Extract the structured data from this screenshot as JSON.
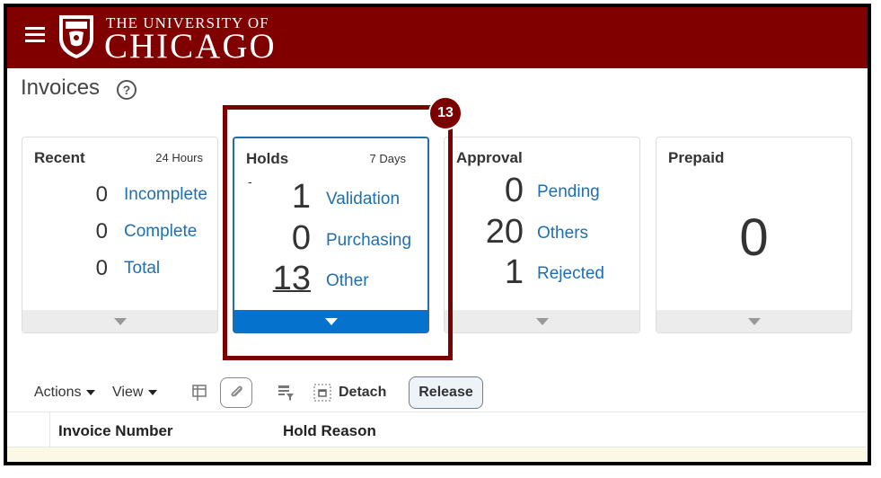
{
  "header": {
    "brand_top": "THE UNIVERSITY OF",
    "brand_main": "CHICAGO",
    "bg_color": "#800000"
  },
  "page": {
    "title": "Invoices",
    "help_icon": "question-circle-icon"
  },
  "cards": {
    "recent": {
      "title": "Recent",
      "period": "24 Hours",
      "rows": [
        {
          "count": "0",
          "label": "Incomplete"
        },
        {
          "count": "0",
          "label": "Complete"
        },
        {
          "count": "0",
          "label": "Total"
        }
      ]
    },
    "holds": {
      "title": "Holds",
      "period": "7 Days",
      "dash": "-",
      "rows": [
        {
          "count": "1",
          "label": "Validation"
        },
        {
          "count": "0",
          "label": "Purchasing"
        },
        {
          "count": "13",
          "label": "Other"
        }
      ]
    },
    "approval": {
      "title": "Approval",
      "rows": [
        {
          "count": "0",
          "label": "Pending"
        },
        {
          "count": "20",
          "label": "Others"
        },
        {
          "count": "1",
          "label": "Rejected"
        }
      ]
    },
    "prepaid": {
      "title": "Prepaid",
      "count": "0"
    }
  },
  "callout": {
    "badge": "13",
    "color": "#7b0000"
  },
  "toolbar": {
    "actions_label": "Actions",
    "view_label": "View",
    "detach_label": "Detach",
    "release_label": "Release"
  },
  "table": {
    "columns": [
      "Invoice Number",
      "Hold Reason"
    ]
  },
  "colors": {
    "link": "#1f6fb0",
    "accent": "#0572ce"
  }
}
